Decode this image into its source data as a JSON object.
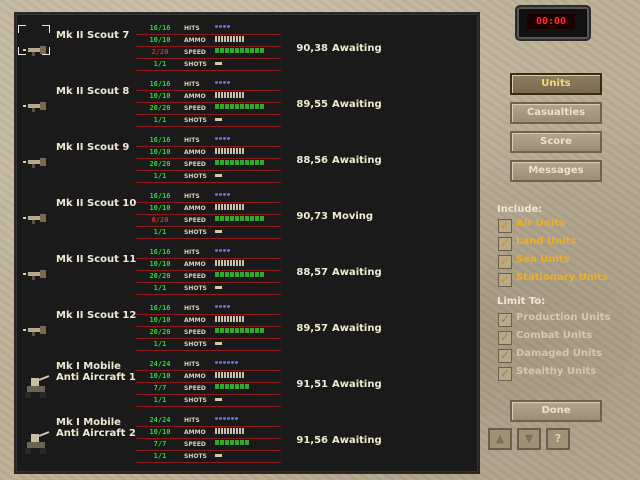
{
  "timer": "00:00",
  "tabs": [
    {
      "label": "Units",
      "active": true
    },
    {
      "label": "Casualties",
      "active": false
    },
    {
      "label": "Score",
      "active": false
    },
    {
      "label": "Messages",
      "active": false
    }
  ],
  "include_label": "Include:",
  "include_items": [
    {
      "label": "Air Units",
      "checked": true
    },
    {
      "label": "Land Units",
      "checked": true
    },
    {
      "label": "Sea Units",
      "checked": true
    },
    {
      "label": "Stationary Units",
      "checked": true
    }
  ],
  "limit_label": "Limit To:",
  "limit_items": [
    {
      "label": "Production Units",
      "checked": false
    },
    {
      "label": "Combat Units",
      "checked": false
    },
    {
      "label": "Damaged Units",
      "checked": false
    },
    {
      "label": "Stealthy Units",
      "checked": false
    }
  ],
  "done_label": "Done",
  "nav": {
    "up": "▲",
    "down": "▼",
    "help": "?"
  },
  "stat_labels": {
    "hits": "HITS",
    "ammo": "AMMO",
    "speed": "SPEED",
    "shots": "SHOTS"
  },
  "units": [
    {
      "name": "Mk II Scout 7",
      "type": "scout",
      "selected": true,
      "hits": "16/16",
      "ammo": "10/10",
      "speed": "2/20",
      "speed_low": true,
      "shots": "1/1",
      "coords": "90,38",
      "status": "Awaiting"
    },
    {
      "name": "Mk II Scout 8",
      "type": "scout",
      "selected": false,
      "hits": "16/16",
      "ammo": "10/10",
      "speed": "20/20",
      "speed_low": false,
      "shots": "1/1",
      "coords": "89,55",
      "status": "Awaiting"
    },
    {
      "name": "Mk II Scout 9",
      "type": "scout",
      "selected": false,
      "hits": "16/16",
      "ammo": "10/10",
      "speed": "20/20",
      "speed_low": false,
      "shots": "1/1",
      "coords": "88,56",
      "status": "Awaiting"
    },
    {
      "name": "Mk II Scout 10",
      "type": "scout",
      "selected": false,
      "hits": "16/16",
      "ammo": "10/10",
      "speed": "0/20",
      "speed_low": true,
      "shots": "1/1",
      "coords": "90,73",
      "status": "Moving"
    },
    {
      "name": "Mk II Scout 11",
      "type": "scout",
      "selected": false,
      "hits": "16/16",
      "ammo": "10/10",
      "speed": "20/20",
      "speed_low": false,
      "shots": "1/1",
      "coords": "88,57",
      "status": "Awaiting"
    },
    {
      "name": "Mk II Scout 12",
      "type": "scout",
      "selected": false,
      "hits": "16/16",
      "ammo": "10/10",
      "speed": "20/20",
      "speed_low": false,
      "shots": "1/1",
      "coords": "89,57",
      "status": "Awaiting"
    },
    {
      "name": "Mk I Mobile Anti Aircraft 1",
      "type": "aa",
      "selected": false,
      "hits": "24/24",
      "ammo": "10/10",
      "speed": "7/7",
      "speed_low": false,
      "shots": "1/1",
      "coords": "91,51",
      "status": "Awaiting"
    },
    {
      "name": "Mk I Mobile Anti Aircraft 2",
      "type": "aa",
      "selected": false,
      "hits": "24/24",
      "ammo": "10/10",
      "speed": "7/7",
      "speed_low": false,
      "shots": "1/1",
      "coords": "91,56",
      "status": "Awaiting"
    }
  ],
  "colors": {
    "stat_ok": "#2ed82e",
    "stat_low": "#e03020",
    "checked_text": "#f2b018",
    "timer_text": "#ff2a2a"
  }
}
